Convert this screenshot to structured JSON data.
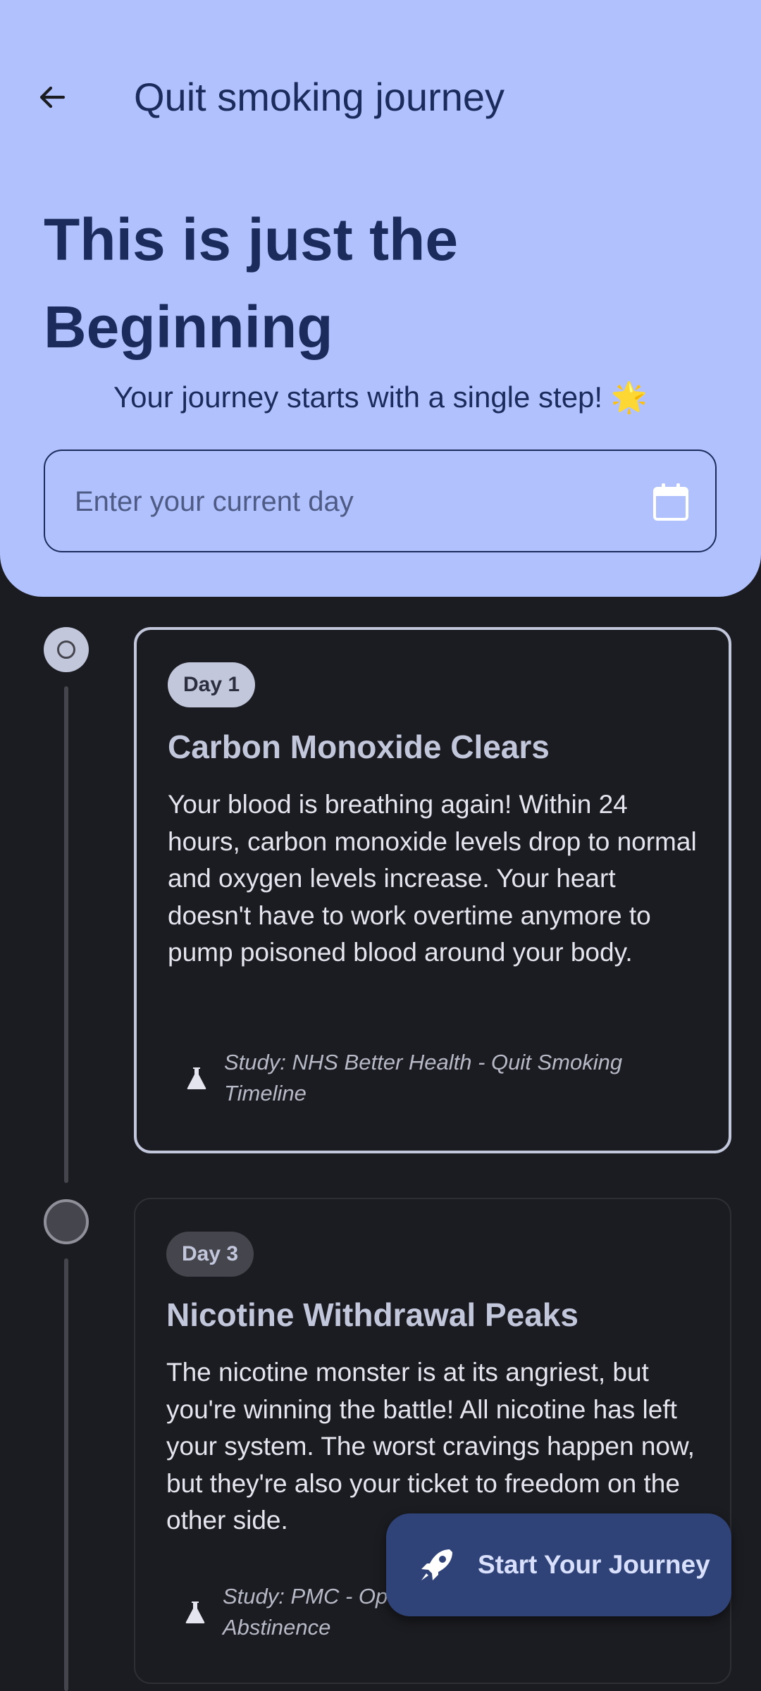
{
  "header": {
    "title": "Quit smoking journey",
    "hero_title": "This is just the Beginning",
    "hero_subtitle": "Your journey starts with a single step! 🌟",
    "day_input": {
      "placeholder": "Enter your current day"
    }
  },
  "timeline": [
    {
      "day": "Day 1",
      "title": "Carbon Monoxide Clears",
      "body": "Your blood is breathing again! Within 24 hours, carbon monoxide levels drop to normal and oxygen levels increase. Your heart doesn't have to work overtime anymore to pump poisoned blood around your body.",
      "study": "Study: NHS Better Health - Quit Smoking Timeline",
      "state": "current"
    },
    {
      "day": "Day 3",
      "title": "Nicotine Withdrawal Peaks",
      "body": "The nicotine monster is at its angriest, but you're winning the battle! All nicotine has left your system. The worst cravings happen now, but they're also your ticket to freedom on the other side.",
      "study": "Study: PMC - Optimal Criteria for 24-hr Smoking Abstinence",
      "state": "upcoming"
    }
  ],
  "fab": {
    "label": "Start Your Journey",
    "icon": "rocket-icon"
  },
  "colors": {
    "header_bg": "#b1c1fd",
    "header_text": "#1b2c5c",
    "page_bg": "#1b1c21",
    "fab_bg": "#2f4378",
    "card_outline_active": "#c3c7dc"
  }
}
